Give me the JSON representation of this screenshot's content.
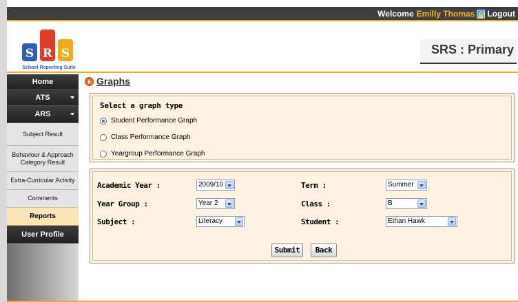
{
  "topbar": {
    "welcome_label": "Welcome",
    "user_name": "Emilly Thomas",
    "lock_icon": "lock-icon",
    "logout_label": "Logout"
  },
  "header": {
    "logo_letters": [
      "S",
      "R",
      "S"
    ],
    "logo_caption": "School Reporting Suite",
    "app_title": "SRS : Primary",
    "accent_color": "#f5a623"
  },
  "sidebar": {
    "items": [
      {
        "label": "Home"
      },
      {
        "label": "ATS"
      },
      {
        "label": "ARS"
      },
      {
        "label": "Subject Result"
      },
      {
        "label": "Behaviour & Approach Category Result"
      },
      {
        "label": "Extra-Curricular Activity"
      },
      {
        "label": "Comments"
      },
      {
        "label": "Reports"
      },
      {
        "label": "User Profile"
      }
    ]
  },
  "main": {
    "title": "Graphs",
    "graph_type": {
      "heading": "Select a graph type",
      "options": [
        {
          "label": "Student Performance Graph",
          "checked": true
        },
        {
          "label": "Class Performance Graph",
          "checked": false
        },
        {
          "label": "Yeargroup Performance Graph",
          "checked": false
        }
      ]
    },
    "filters": {
      "academic_year": {
        "label": "Academic Year :",
        "value": "2009/10"
      },
      "term": {
        "label": "Term :",
        "value": "Summer"
      },
      "year_group": {
        "label": "Year Group :",
        "value": "Year 2"
      },
      "class": {
        "label": "Class :",
        "value": "B"
      },
      "subject": {
        "label": "Subject :",
        "value": "Literacy"
      },
      "student": {
        "label": "Student :",
        "value": "Ethan Hawk"
      }
    },
    "buttons": {
      "submit": "Submit",
      "back": "Back"
    }
  }
}
